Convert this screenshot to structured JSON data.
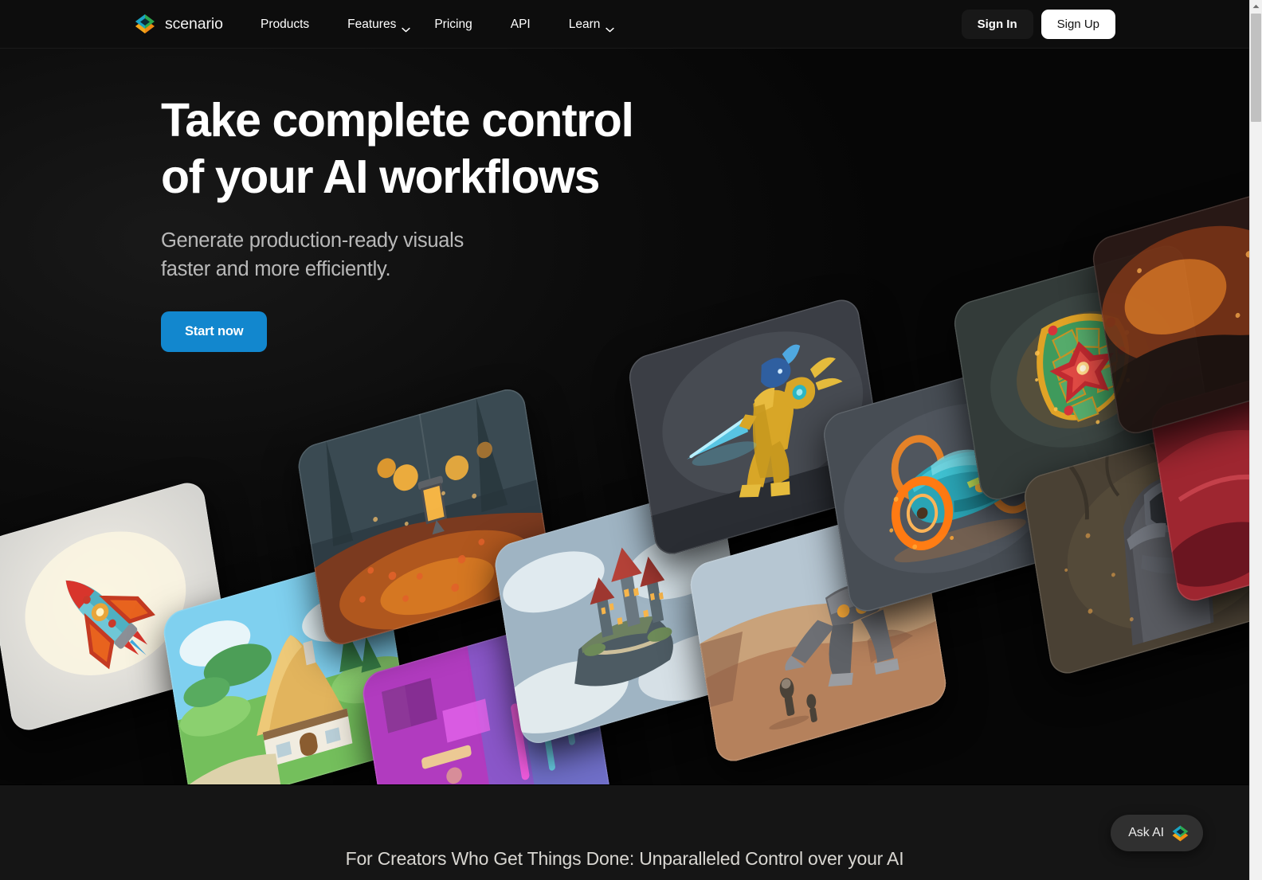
{
  "brand": {
    "name": "scenario",
    "logo_icon": "scenario-diamond-logo-icon",
    "logo_colors": {
      "top_left": "#1fa5c4",
      "top_right": "#2fae55",
      "bottom_left": "#f0a21a",
      "bottom_right": "#ef7a16",
      "center": "#0f2d3a"
    }
  },
  "nav": {
    "items": [
      {
        "label": "Products",
        "caret": false
      },
      {
        "label": "Features",
        "caret": true
      },
      {
        "label": "Pricing",
        "caret": false
      },
      {
        "label": "API",
        "caret": false
      },
      {
        "label": "Learn",
        "caret": true
      }
    ],
    "sign_in_label": "Sign In",
    "sign_up_label": "Sign Up"
  },
  "hero": {
    "headline": "Take complete control\nof your AI workflows",
    "subhead": "Generate production-ready visuals\nfaster and more efficiently.",
    "cta_label": "Start now",
    "cta_color": "#1287ce",
    "background_color": "#050505"
  },
  "gallery": {
    "cards": [
      {
        "id": "rocket",
        "name": "cartoon-rocket-ship",
        "alt": "Stylized red and teal cartoon rocket on cream background"
      },
      {
        "id": "cottage",
        "name": "storybook-cottage",
        "alt": "Thatched-roof storybook cottage in a green meadow"
      },
      {
        "id": "neon",
        "name": "neon-cyberpunk-room",
        "alt": "Magenta and cyan neon-lit interior"
      },
      {
        "id": "lantern",
        "name": "autumn-lantern-forest",
        "alt": "Glowing lanterns over an autumn leaf path"
      },
      {
        "id": "castle",
        "name": "floating-sky-castle",
        "alt": "Castle on a floating island above clouds"
      },
      {
        "id": "warrior",
        "name": "golden-armored-warrior",
        "alt": "Blue and gold armored warrior with a glowing blue sword"
      },
      {
        "id": "mech",
        "name": "desert-mech-walker",
        "alt": "Mech walker and two figures crossing a desert"
      },
      {
        "id": "car",
        "name": "neon-wheel-race-car",
        "alt": "Teal race car with orange glowing energy wheels"
      },
      {
        "id": "shield",
        "name": "emerald-gold-shield",
        "alt": "Green and gold shield with a red gem flower"
      },
      {
        "id": "sorcerer",
        "name": "hooded-spellcaster",
        "alt": "Hooded figure conjuring embers in both hands"
      },
      {
        "id": "red",
        "name": "crimson-fabric-scene",
        "alt": "Partially visible deep red scene at right edge"
      },
      {
        "id": "volcano",
        "name": "volcanic-ember-scene",
        "alt": "Partially visible volcanic ember scene"
      }
    ]
  },
  "section_below": {
    "heading": "For Creators Who Get Things Done: Unparalleled Control over your AI"
  },
  "ask_ai": {
    "label": "Ask AI",
    "icon": "scenario-diamond-logo-icon"
  },
  "scrollbar": {
    "up_arrow_icon": "scroll-up-arrow-icon",
    "thumb_icon": "scrollbar-thumb"
  }
}
